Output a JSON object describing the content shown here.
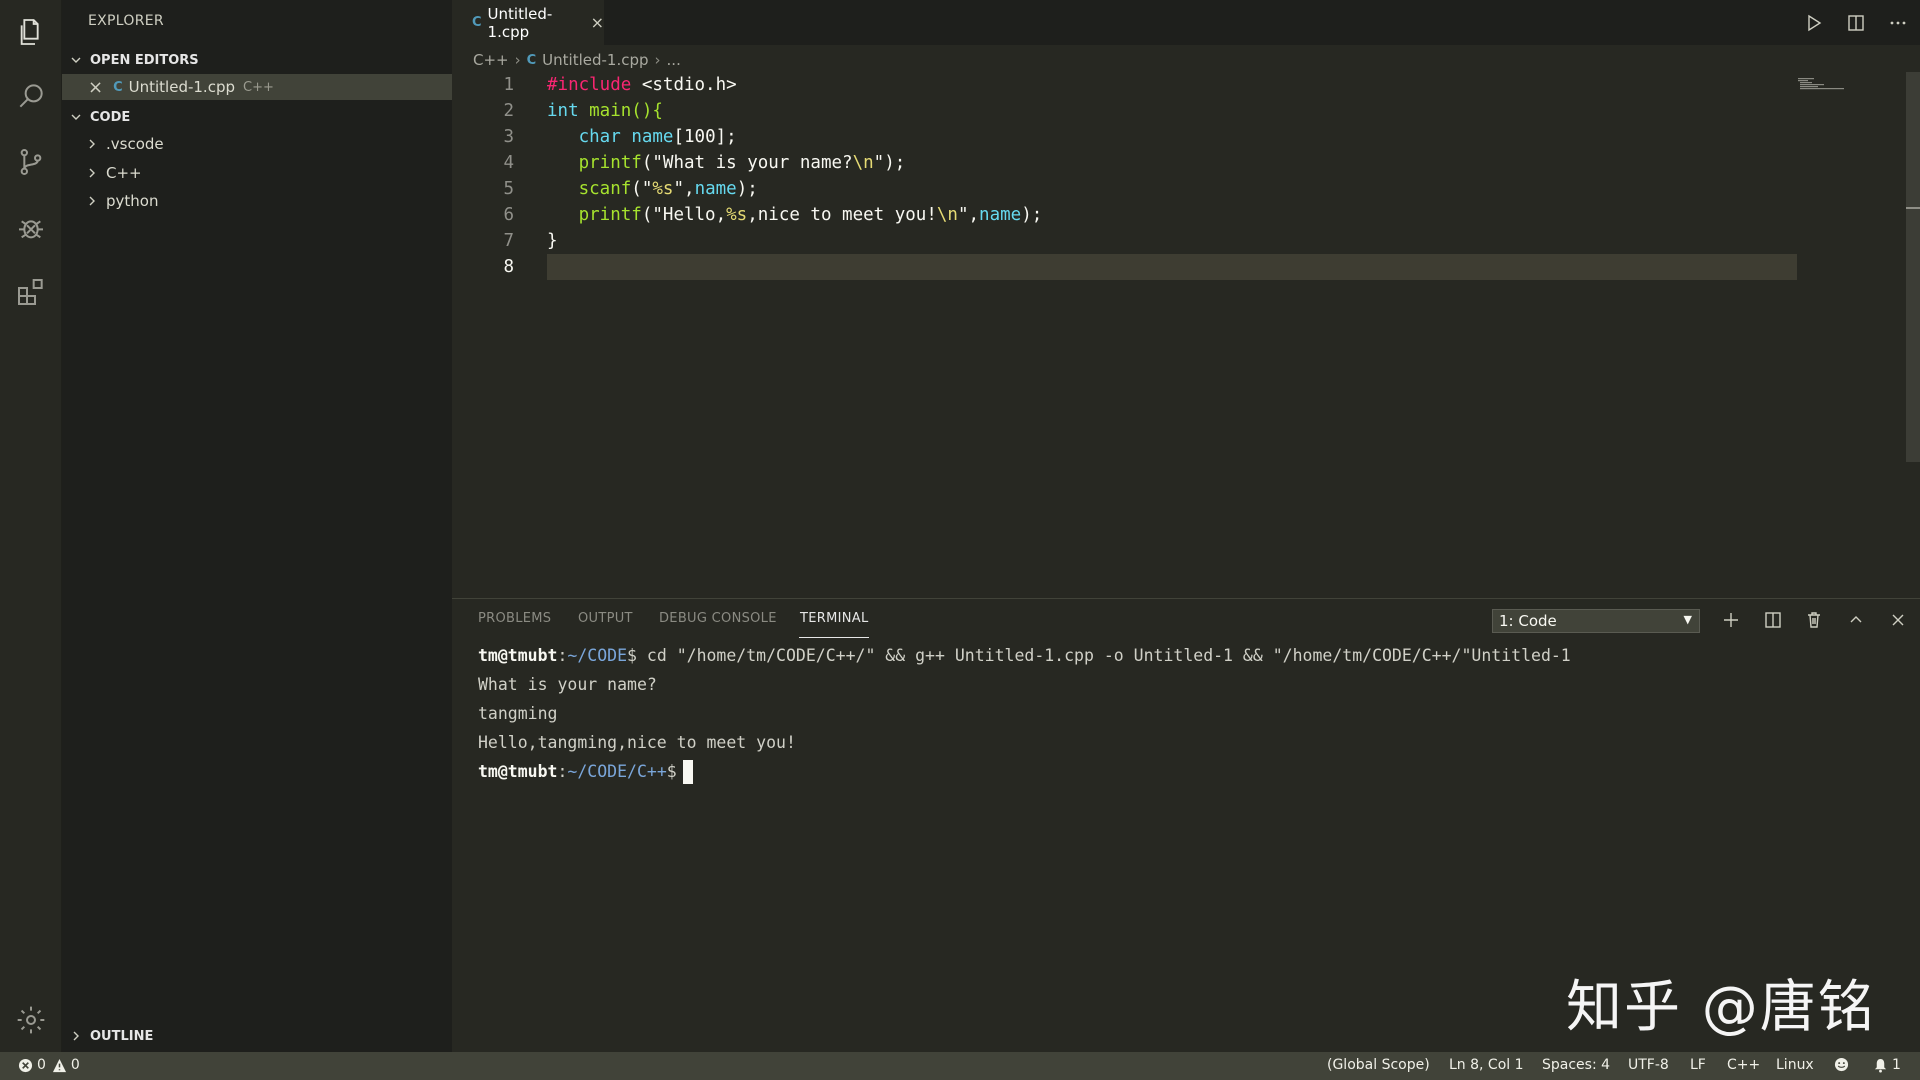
{
  "sidebar": {
    "title": "EXPLORER",
    "open_editors_label": "OPEN EDITORS",
    "open_editor": {
      "close": "×",
      "icon": "C",
      "name": "Untitled-1.cpp",
      "lang": "C++"
    },
    "folder_label": "CODE",
    "folders": [
      ".vscode",
      "C++",
      "python"
    ],
    "outline_label": "OUTLINE"
  },
  "tab": {
    "icon": "C",
    "name": "Untitled-1.cpp",
    "close": "×"
  },
  "breadcrumb": {
    "folder": "C++",
    "file_icon": "C",
    "file": "Untitled-1.cpp",
    "tail": "..."
  },
  "editor": {
    "line_numbers": [
      "1",
      "2",
      "3",
      "4",
      "5",
      "6",
      "7",
      "8"
    ],
    "l1": {
      "a": "#include",
      "b": " <stdio.h>"
    },
    "l2": {
      "a": "int",
      "b": " main(){"
    },
    "l3": {
      "indent": "   ",
      "a": "char",
      "b": " ",
      "c": "name",
      "d": "[100];"
    },
    "l4": {
      "indent": "   ",
      "fn": "printf",
      "p1": "(",
      "s1": "\"What is your name?",
      "esc": "\\n",
      "s2": "\"",
      "p2": ");"
    },
    "l5": {
      "indent": "   ",
      "fn": "scanf",
      "p1": "(",
      "s1": "\"",
      "fmt": "%s",
      "s2": "\"",
      "p2": ",",
      "v": "name",
      "p3": ");"
    },
    "l6": {
      "indent": "   ",
      "fn": "printf",
      "p1": "(",
      "s1": "\"Hello,",
      "fmt": "%s",
      "s2": ",nice to meet you!",
      "esc": "\\n",
      "s3": "\"",
      "p2": ",",
      "v": "name",
      "p3": ");"
    },
    "l7": "}"
  },
  "panel": {
    "tabs": [
      "PROBLEMS",
      "OUTPUT",
      "DEBUG CONSOLE",
      "TERMINAL"
    ],
    "terminal_select": "1: Code",
    "terminal_lines": {
      "t1_user": "tm@tmubt",
      "t1_colon": ":",
      "t1_path": "~/CODE",
      "t1_cmd": "$ cd \"/home/tm/CODE/C++/\" && g++ Untitled-1.cpp -o Untitled-1 && \"/home/tm/CODE/C++/\"Untitled-1",
      "t2": "What is your name?",
      "t3": "tangming",
      "t4": "Hello,tangming,nice to meet you!",
      "t5_user": "tm@tmubt",
      "t5_colon": ":",
      "t5_path": "~/CODE/C++",
      "t5_prompt": "$"
    }
  },
  "watermark": "知乎 @唐铭",
  "statusbar": {
    "errors": "0",
    "warnings": "0",
    "scope": "(Global Scope)",
    "position": "Ln 8, Col 1",
    "spaces": "Spaces: 4",
    "encoding": "UTF-8",
    "eol": "LF",
    "language": "C++",
    "os": "Linux",
    "notifications": "1"
  },
  "colors": {
    "accent_cpp_icon": "#519aba",
    "background": "#272822",
    "sidebar": "#1e1f1c"
  }
}
